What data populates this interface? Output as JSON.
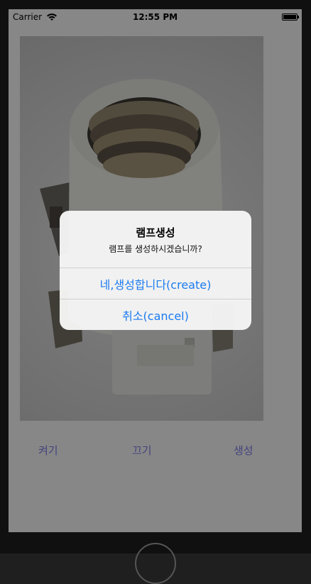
{
  "status_bar": {
    "carrier": "Carrier",
    "time": "12:55 PM"
  },
  "image": {
    "description_icon": "lamp-socket-icon"
  },
  "buttons": {
    "on": "켜기",
    "off": "끄기",
    "create": "생성"
  },
  "alert": {
    "title": "램프생성",
    "message": "램프를 생성하시겠습니까?",
    "confirm": "네,생성합니다(create)",
    "cancel": "취소(cancel)"
  },
  "colors": {
    "accent": "#1a7bf0",
    "button_text": "#7f7ff0"
  }
}
